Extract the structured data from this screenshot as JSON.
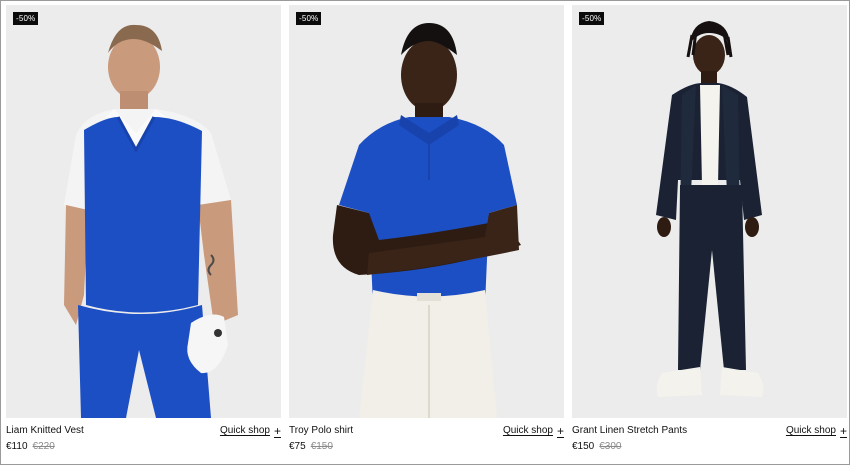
{
  "products": [
    {
      "badge": "-50%",
      "name": "Liam Knitted Vest",
      "price": "€110",
      "original_price": "€220",
      "quick_shop": "Quick shop",
      "plus": "+"
    },
    {
      "badge": "-50%",
      "name": "Troy Polo shirt",
      "price": "€75",
      "original_price": "€150",
      "quick_shop": "Quick shop",
      "plus": "+"
    },
    {
      "badge": "-50%",
      "name": "Grant Linen Stretch Pants",
      "price": "€150",
      "original_price": "€300",
      "quick_shop": "Quick shop",
      "plus": "+"
    }
  ],
  "colors": {
    "background": "#ececec",
    "badge_bg": "#0b0b0b",
    "strike_price": "#8a8a8a",
    "royal_blue": "#1d4fc4",
    "navy": "#1a2233"
  }
}
